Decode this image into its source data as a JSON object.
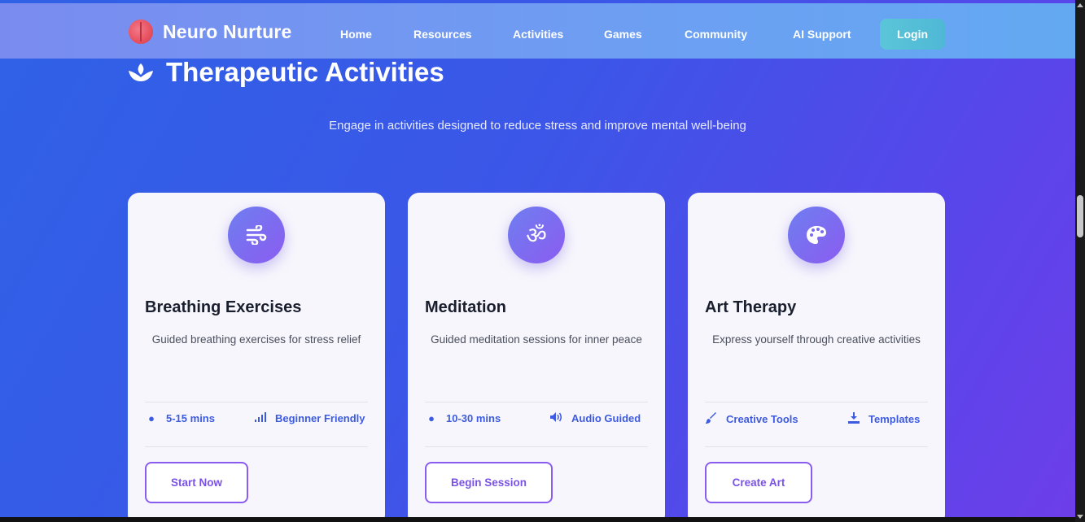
{
  "navbar": {
    "brand": "Neuro Nurture",
    "items": [
      {
        "label": "Home"
      },
      {
        "label": "Resources"
      },
      {
        "label": "Activities"
      },
      {
        "label": "Games"
      },
      {
        "label": "Community"
      },
      {
        "label": "AI Support"
      }
    ],
    "login_label": "Login"
  },
  "section": {
    "title": "Therapeutic Activities",
    "subtitle": "Engage in activities designed to reduce stress and improve mental well-being"
  },
  "cards": [
    {
      "icon": "wind-icon",
      "title": "Breathing Exercises",
      "description": "Guided breathing exercises for stress relief",
      "meta": [
        {
          "icon": "clock-icon",
          "label": "5-15 mins"
        },
        {
          "icon": "signal-icon",
          "label": "Beginner Friendly"
        }
      ],
      "button_label": "Start Now"
    },
    {
      "icon": "om-icon",
      "title": "Meditation",
      "description": "Guided meditation sessions for inner peace",
      "meta": [
        {
          "icon": "clock-icon",
          "label": "10-30 mins"
        },
        {
          "icon": "volume-icon",
          "label": "Audio Guided"
        }
      ],
      "button_label": "Begin Session"
    },
    {
      "icon": "palette-icon",
      "title": "Art Therapy",
      "description": "Express yourself through creative activities",
      "meta": [
        {
          "icon": "brush-icon",
          "label": "Creative Tools"
        },
        {
          "icon": "download-icon",
          "label": "Templates"
        }
      ],
      "button_label": "Create Art"
    }
  ],
  "colors": {
    "accent": "#3d5be0",
    "button_border": "#8a5cf0",
    "login": "#5bc5d8"
  }
}
